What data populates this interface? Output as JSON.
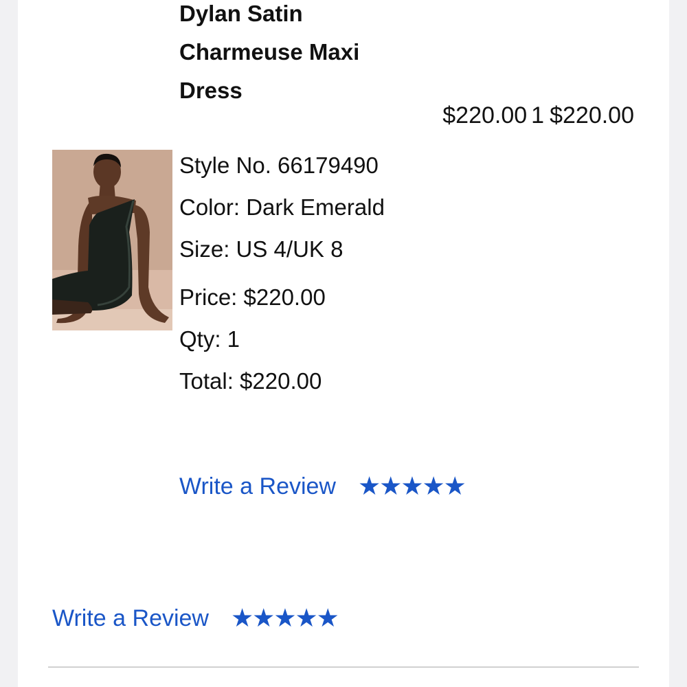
{
  "product": {
    "title_lines": [
      "Dylan Satin",
      "Charmeuse Maxi",
      "Dress"
    ],
    "summary": {
      "unit_price": "$220.00",
      "qty": "1",
      "line_total": "$220.00"
    },
    "details": {
      "style": "Style No.  66179490",
      "color": "Color:  Dark Emerald",
      "size": "Size:  US 4/UK 8",
      "price": "Price: $220.00",
      "qty": "Qty: 1",
      "total": "Total: $220.00"
    },
    "image_alt": "Model wearing dark emerald one-shoulder satin dress"
  },
  "reviews": {
    "item_link": "Write a Review",
    "item_stars": "★★★★★",
    "footer_link": "Write a Review",
    "footer_stars": "★★★★★"
  },
  "colors": {
    "link": "#1a56c7",
    "text": "#111111",
    "card": "#ffffff",
    "background": "#f1f1f3"
  }
}
